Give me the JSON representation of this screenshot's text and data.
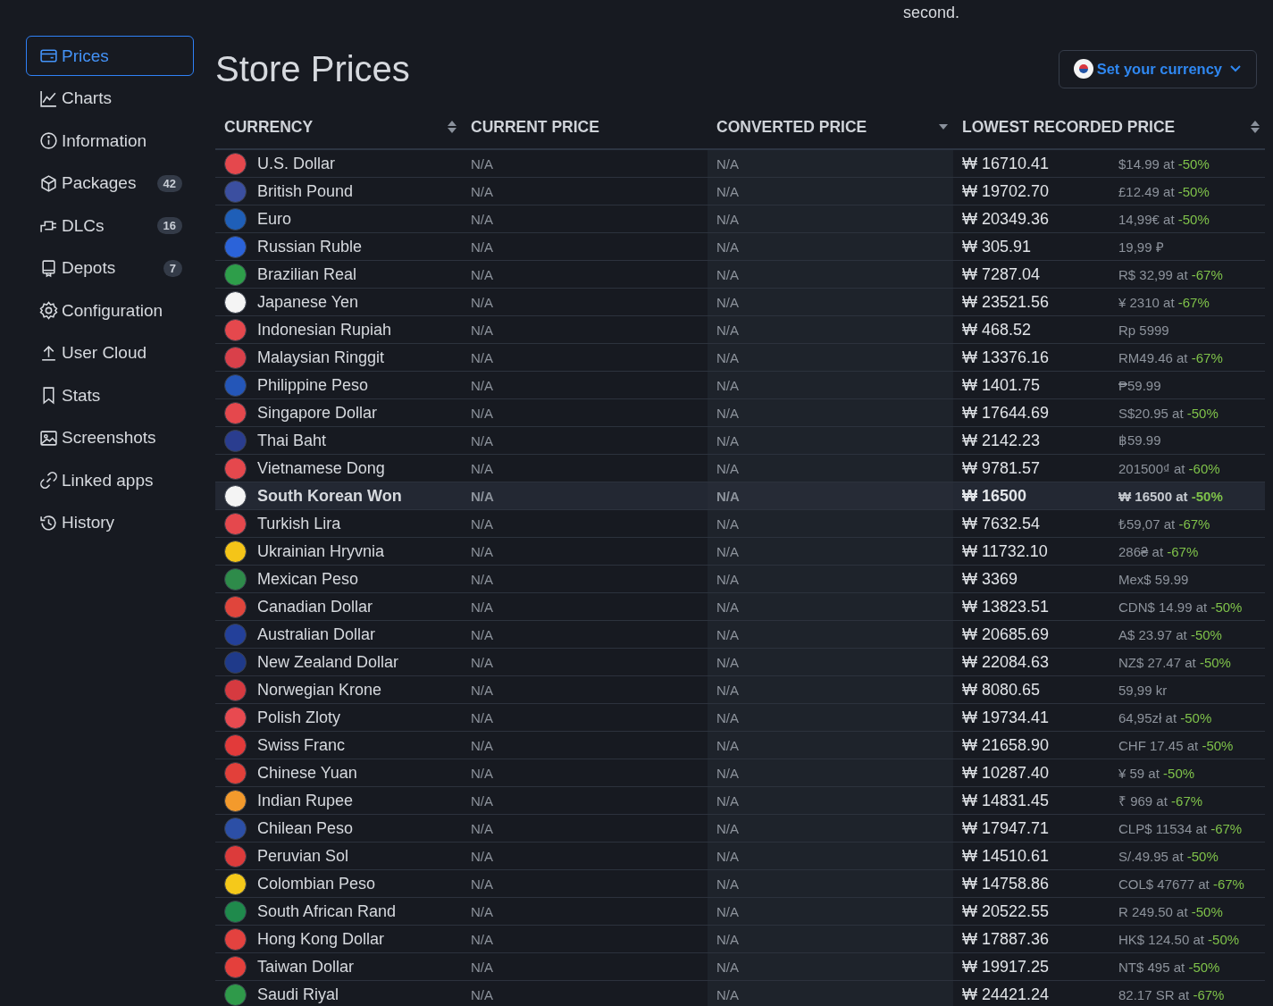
{
  "top_note": "second.",
  "sidebar": {
    "items": [
      {
        "label": "Prices",
        "selected": true
      },
      {
        "label": "Charts",
        "selected": false
      },
      {
        "label": "Information",
        "selected": false
      },
      {
        "label": "Packages",
        "badge": "42",
        "selected": false
      },
      {
        "label": "DLCs",
        "badge": "16",
        "selected": false
      },
      {
        "label": "Depots",
        "badge": "7",
        "selected": false
      },
      {
        "label": "Configuration",
        "selected": false
      },
      {
        "label": "User Cloud",
        "selected": false
      },
      {
        "label": "Stats",
        "selected": false
      },
      {
        "label": "Screenshots",
        "selected": false
      },
      {
        "label": "Linked apps",
        "selected": false
      },
      {
        "label": "History",
        "selected": false
      }
    ]
  },
  "title": "Store Prices",
  "currency_button": {
    "label": "Set your currency"
  },
  "table": {
    "columns": [
      {
        "label": "CURRENCY",
        "sort_up": true,
        "sort_down": true
      },
      {
        "label": "CURRENT PRICE",
        "sort_up": false,
        "sort_down": false
      },
      {
        "label": "CONVERTED PRICE",
        "sort_up": false,
        "sort_down": true
      },
      {
        "label": "LOWEST RECORDED PRICE",
        "sort_up": true,
        "sort_down": true
      }
    ],
    "rows": [
      {
        "currency": "U.S. Dollar",
        "color": "#e5484d",
        "current": "N/A",
        "converted": "N/A",
        "lowest": "₩ 16710.41",
        "lowest_local": "$14.99 at",
        "discount": "-50%",
        "selected": false
      },
      {
        "currency": "British Pound",
        "color": "#3b4fa0",
        "current": "N/A",
        "converted": "N/A",
        "lowest": "₩ 19702.70",
        "lowest_local": "£12.49 at",
        "discount": "-50%",
        "selected": false
      },
      {
        "currency": "Euro",
        "color": "#1f5fb8",
        "current": "N/A",
        "converted": "N/A",
        "lowest": "₩ 20349.36",
        "lowest_local": "14,99€ at",
        "discount": "-50%",
        "selected": false
      },
      {
        "currency": "Russian Ruble",
        "color": "#2b63d9",
        "current": "N/A",
        "converted": "N/A",
        "lowest": "₩ 305.91",
        "lowest_local": "19,99 ₽",
        "selected": false
      },
      {
        "currency": "Brazilian Real",
        "color": "#2e9e4a",
        "current": "N/A",
        "converted": "N/A",
        "lowest": "₩ 7287.04",
        "lowest_local": "R$ 32,99 at",
        "discount": "-67%",
        "selected": false
      },
      {
        "currency": "Japanese Yen",
        "color": "#f4f4f4",
        "current": "N/A",
        "converted": "N/A",
        "lowest": "₩ 23521.56",
        "lowest_local": "¥ 2310 at",
        "discount": "-67%",
        "selected": false
      },
      {
        "currency": "Indonesian Rupiah",
        "color": "#e5484d",
        "current": "N/A",
        "converted": "N/A",
        "lowest": "₩ 468.52",
        "lowest_local": "Rp 5999",
        "selected": false
      },
      {
        "currency": "Malaysian Ringgit",
        "color": "#d9404a",
        "current": "N/A",
        "converted": "N/A",
        "lowest": "₩ 13376.16",
        "lowest_local": "RM49.46 at",
        "discount": "-67%",
        "selected": false
      },
      {
        "currency": "Philippine Peso",
        "color": "#2456b8",
        "current": "N/A",
        "converted": "N/A",
        "lowest": "₩ 1401.75",
        "lowest_local": "₱59.99",
        "selected": false
      },
      {
        "currency": "Singapore Dollar",
        "color": "#e5484d",
        "current": "N/A",
        "converted": "N/A",
        "lowest": "₩ 17644.69",
        "lowest_local": "S$20.95 at",
        "discount": "-50%",
        "selected": false
      },
      {
        "currency": "Thai Baht",
        "color": "#2a3d8f",
        "current": "N/A",
        "converted": "N/A",
        "lowest": "₩ 2142.23",
        "lowest_local": "฿59.99",
        "selected": false
      },
      {
        "currency": "Vietnamese Dong",
        "color": "#e5484d",
        "current": "N/A",
        "converted": "N/A",
        "lowest": "₩ 9781.57",
        "lowest_local": "201500₫ at",
        "discount": "-60%",
        "selected": false
      },
      {
        "currency": "South Korean Won",
        "color": "#f4f4f4",
        "current": "N/A",
        "converted": "N/A",
        "lowest": "₩ 16500",
        "lowest_local": "₩ 16500 at",
        "discount": "-50%",
        "selected": true
      },
      {
        "currency": "Turkish Lira",
        "color": "#e5484d",
        "current": "N/A",
        "converted": "N/A",
        "lowest": "₩ 7632.54",
        "lowest_local": "₺59,07 at",
        "discount": "-67%",
        "selected": false
      },
      {
        "currency": "Ukrainian Hryvnia",
        "color": "#f5c518",
        "current": "N/A",
        "converted": "N/A",
        "lowest": "₩ 11732.10",
        "lowest_local": "286₴ at",
        "discount": "-67%",
        "selected": false
      },
      {
        "currency": "Mexican Peso",
        "color": "#2e8b4a",
        "current": "N/A",
        "converted": "N/A",
        "lowest": "₩ 3369",
        "lowest_local": "Mex$ 59.99",
        "selected": false
      },
      {
        "currency": "Canadian Dollar",
        "color": "#e0453c",
        "current": "N/A",
        "converted": "N/A",
        "lowest": "₩ 13823.51",
        "lowest_local": "CDN$ 14.99 at",
        "discount": "-50%",
        "selected": false
      },
      {
        "currency": "Australian Dollar",
        "color": "#23409a",
        "current": "N/A",
        "converted": "N/A",
        "lowest": "₩ 20685.69",
        "lowest_local": "A$ 23.97 at",
        "discount": "-50%",
        "selected": false
      },
      {
        "currency": "New Zealand Dollar",
        "color": "#1f3a8a",
        "current": "N/A",
        "converted": "N/A",
        "lowest": "₩ 22084.63",
        "lowest_local": "NZ$ 27.47 at",
        "discount": "-50%",
        "selected": false
      },
      {
        "currency": "Norwegian Krone",
        "color": "#d63a40",
        "current": "N/A",
        "converted": "N/A",
        "lowest": "₩ 8080.65",
        "lowest_local": "59,99 kr",
        "selected": false
      },
      {
        "currency": "Polish Zloty",
        "color": "#e84a50",
        "current": "N/A",
        "converted": "N/A",
        "lowest": "₩ 19734.41",
        "lowest_local": "64,95zł at",
        "discount": "-50%",
        "selected": false
      },
      {
        "currency": "Swiss Franc",
        "color": "#e23a3a",
        "current": "N/A",
        "converted": "N/A",
        "lowest": "₩ 21658.90",
        "lowest_local": "CHF 17.45 at",
        "discount": "-50%",
        "selected": false
      },
      {
        "currency": "Chinese Yuan",
        "color": "#e2403a",
        "current": "N/A",
        "converted": "N/A",
        "lowest": "₩ 10287.40",
        "lowest_local": "¥ 59 at",
        "discount": "-50%",
        "selected": false
      },
      {
        "currency": "Indian Rupee",
        "color": "#f39a2c",
        "current": "N/A",
        "converted": "N/A",
        "lowest": "₩ 14831.45",
        "lowest_local": "₹ 969 at",
        "discount": "-67%",
        "selected": false
      },
      {
        "currency": "Chilean Peso",
        "color": "#2c4fa6",
        "current": "N/A",
        "converted": "N/A",
        "lowest": "₩ 17947.71",
        "lowest_local": "CLP$ 11534 at",
        "discount": "-67%",
        "selected": false
      },
      {
        "currency": "Peruvian Sol",
        "color": "#dc3b3b",
        "current": "N/A",
        "converted": "N/A",
        "lowest": "₩ 14510.61",
        "lowest_local": "S/.49.95 at",
        "discount": "-50%",
        "selected": false
      },
      {
        "currency": "Colombian Peso",
        "color": "#f5c91a",
        "current": "N/A",
        "converted": "N/A",
        "lowest": "₩ 14758.86",
        "lowest_local": "COL$ 47677 at",
        "discount": "-67%",
        "selected": false
      },
      {
        "currency": "South African Rand",
        "color": "#1f8a4c",
        "current": "N/A",
        "converted": "N/A",
        "lowest": "₩ 20522.55",
        "lowest_local": "R 249.50 at",
        "discount": "-50%",
        "selected": false
      },
      {
        "currency": "Hong Kong Dollar",
        "color": "#e3423f",
        "current": "N/A",
        "converted": "N/A",
        "lowest": "₩ 17887.36",
        "lowest_local": "HK$ 124.50 at",
        "discount": "-50%",
        "selected": false
      },
      {
        "currency": "Taiwan Dollar",
        "color": "#e4403c",
        "current": "N/A",
        "converted": "N/A",
        "lowest": "₩ 19917.25",
        "lowest_local": "NT$ 495 at",
        "discount": "-50%",
        "selected": false
      },
      {
        "currency": "Saudi Riyal",
        "color": "#2f9a4a",
        "current": "N/A",
        "converted": "N/A",
        "lowest": "₩ 24421.24",
        "lowest_local": "82.17 SR at",
        "discount": "-67%",
        "selected": false
      }
    ]
  }
}
